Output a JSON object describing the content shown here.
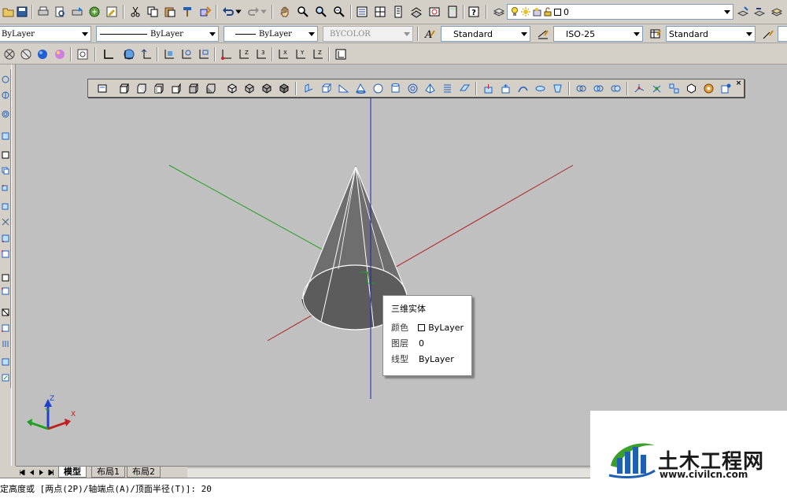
{
  "toolbar_top": {
    "layer_value": "0"
  },
  "properties": {
    "layer_combo": "ByLayer",
    "linetype_combo": "ByLayer",
    "lineweight_combo": "ByLayer",
    "color_combo": "BYCOLOR",
    "text_style": "Standard",
    "dim_style": "ISO-25",
    "table_style": "Standard"
  },
  "tooltip": {
    "title": "三维实体",
    "rows": [
      {
        "key": "颜色",
        "value": "ByLayer"
      },
      {
        "key": "图层",
        "value": "0"
      },
      {
        "key": "线型",
        "value": "ByLayer"
      }
    ]
  },
  "ucs": {
    "x": "X",
    "y": "Y",
    "z": "Z"
  },
  "tabs": {
    "model": "模型",
    "layout1": "布局1",
    "layout2": "布局2"
  },
  "command_line": {
    "text": "定高度或 [两点(2P)/轴端点(A)/顶面半径(T)]: 20"
  },
  "watermark": {
    "title": "土木工程网",
    "url": "www.civilcn.com"
  },
  "colors": {
    "x_axis": "#b02020",
    "y_axis": "#20a020",
    "z_axis": "#2020b0",
    "logo_blue": "#1f5fb4",
    "logo_green": "#3aa02a"
  }
}
